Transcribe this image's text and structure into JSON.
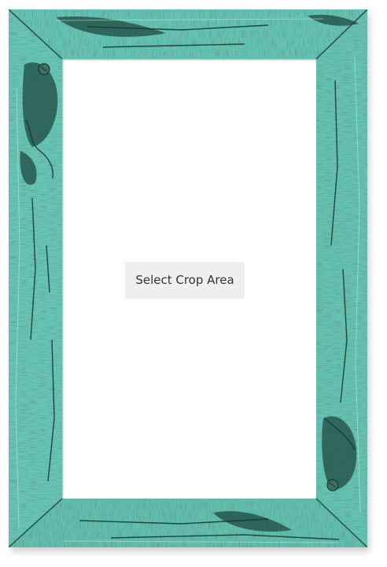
{
  "frame": {
    "style_name": "distressed-turquoise-wood",
    "colors": {
      "wood_base": "#5dbfae",
      "wood_light": "#8fd6c8",
      "wood_dark": "#1f4a41",
      "crack": "#163a32",
      "mat": "#ffffff"
    }
  },
  "crop_button": {
    "label": "Select Crop Area",
    "background": "#efefef",
    "text_color": "#333333"
  }
}
